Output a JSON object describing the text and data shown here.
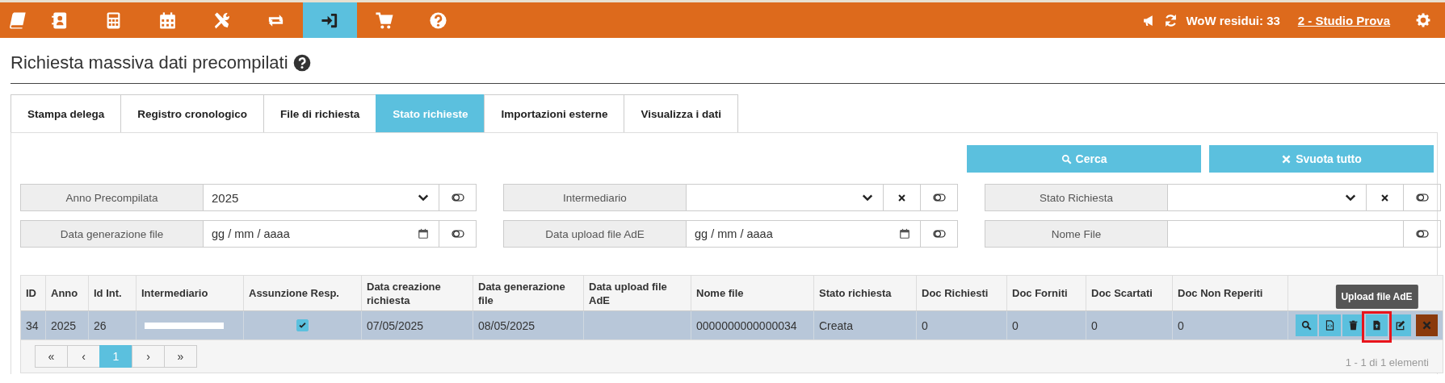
{
  "top_bar": {
    "nav": [
      {
        "kind": "book",
        "selected": false
      },
      {
        "kind": "contacts",
        "selected": false
      },
      {
        "kind": "calculator",
        "selected": false
      },
      {
        "kind": "calendar",
        "selected": false
      },
      {
        "kind": "tools",
        "selected": false
      },
      {
        "kind": "exchange",
        "selected": false
      },
      {
        "kind": "sign-in",
        "selected": true
      },
      {
        "kind": "cart",
        "selected": false
      },
      {
        "kind": "help",
        "selected": false
      }
    ],
    "credits": "WoW residui: 33",
    "studio_link": "2 - Studio Prova"
  },
  "page_title": "Richiesta massiva dati precompilati",
  "tabs": [
    {
      "label": "Stampa delega",
      "selected": false
    },
    {
      "label": "Registro cronologico",
      "selected": false
    },
    {
      "label": "File di richiesta",
      "selected": false
    },
    {
      "label": "Stato richieste",
      "selected": true
    },
    {
      "label": "Importazioni esterne",
      "selected": false
    },
    {
      "label": "Visualizza i dati",
      "selected": false
    }
  ],
  "actions": [
    {
      "kind": "search",
      "label": "Cerca"
    },
    {
      "kind": "clear",
      "label": "Svuota tutto"
    }
  ],
  "filters": [
    {
      "label": "Anno Precompilata",
      "kind": "select",
      "value": "2025",
      "clearable": false
    },
    {
      "label": "Intermediario",
      "kind": "select",
      "clearable": true
    },
    {
      "label": "Stato Richiesta",
      "kind": "select",
      "clearable": true
    },
    {
      "label": "Data generazione file",
      "kind": "date",
      "placeholder": "gg / mm / aaaa",
      "clearable": false
    },
    {
      "label": "Data upload file AdE",
      "kind": "date",
      "placeholder": "gg / mm / aaaa",
      "clearable": false
    },
    {
      "label": "Nome File",
      "kind": "text",
      "clearable": false
    }
  ],
  "table": {
    "columns": [
      "ID",
      "Anno",
      "Id Int.",
      "Intermediario",
      "Assunzione Resp.",
      "Data creazione richiesta",
      "Data generazione file",
      "Data upload file AdE",
      "Nome file",
      "Stato richiesta",
      "Doc Richiesti",
      "Doc Forniti",
      "Doc Scartati",
      "Doc Non Reperiti"
    ],
    "rows": [
      {
        "selected": true,
        "id": "34",
        "anno": "2025",
        "id_int": "26",
        "intermediario_redacted": true,
        "assunzione_resp": true,
        "data_creazione": "07/05/2025",
        "data_generazione": "08/05/2025",
        "nome_file": "0000000000000034",
        "stato": "Creata",
        "doc_richiesti": "0",
        "doc_forniti": "0",
        "doc_scartati": "0",
        "doc_non_reperiti": "0",
        "actions": [
          {
            "kind": "view",
            "highlighted": false
          },
          {
            "kind": "code",
            "highlighted": false
          },
          {
            "kind": "delete",
            "highlighted": false
          },
          {
            "kind": "upload",
            "highlighted": true,
            "tooltip": "Upload file AdE"
          },
          {
            "kind": "edit",
            "highlighted": false
          },
          {
            "kind": "remove",
            "highlighted": false
          }
        ]
      }
    ]
  },
  "pager": {
    "buttons": [
      {
        "label": "«",
        "selected": false
      },
      {
        "label": "‹",
        "selected": false
      },
      {
        "label": "1",
        "selected": true
      },
      {
        "label": "›",
        "selected": false
      },
      {
        "label": "»",
        "selected": false
      }
    ],
    "summary": "1 - 1 di 1 elementi"
  }
}
